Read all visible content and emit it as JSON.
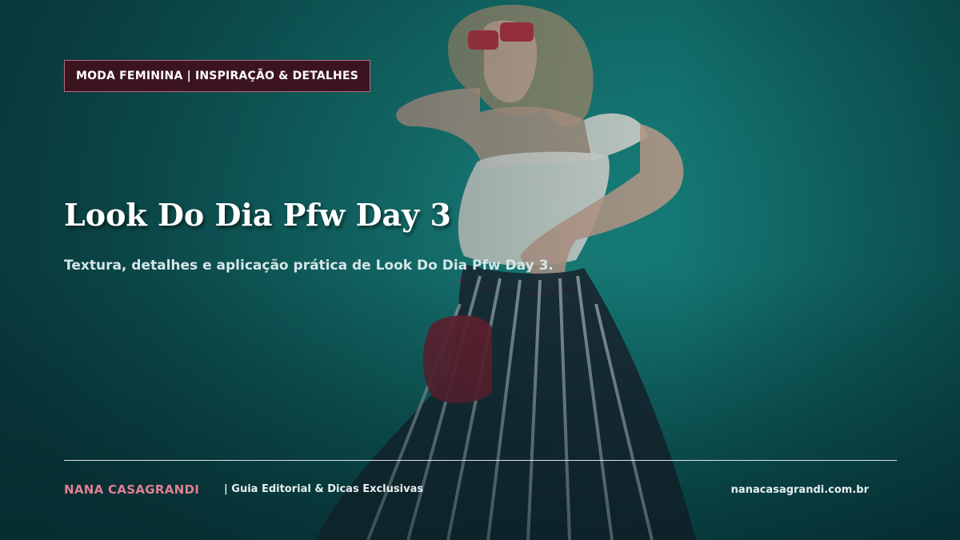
{
  "badge": {
    "label": "MODA FEMININA | INSPIRAÇÃO & DETALHES"
  },
  "hero": {
    "title": "Look Do Dia Pfw Day 3",
    "subtitle": "Textura, detalhes e aplicação prática de Look Do Dia Pfw Day 3."
  },
  "footer": {
    "brand": "NANA CASAGRANDI",
    "tagline": "|  Guia Editorial & Dicas Exclusivas",
    "site": "nanacasagrandi.com.br"
  },
  "colors": {
    "background": "#0f5a5a",
    "badge_bg": "#3c1420",
    "brand_accent": "#e07f93"
  }
}
